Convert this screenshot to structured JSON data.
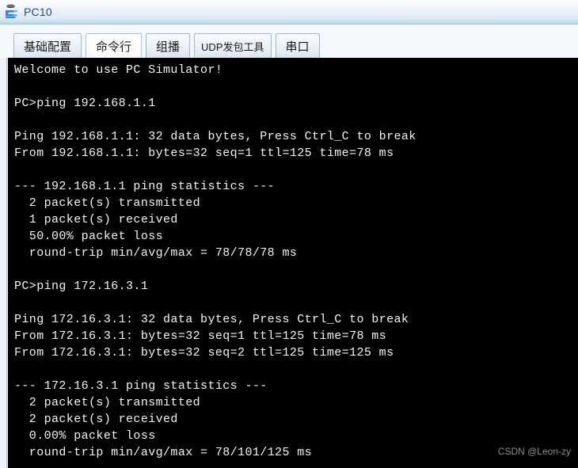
{
  "window": {
    "title": "PC10",
    "icon": "pc-device-icon"
  },
  "tabs": [
    {
      "label": "基础配置",
      "active": false,
      "small": false
    },
    {
      "label": "命令行",
      "active": true,
      "small": false
    },
    {
      "label": "组播",
      "active": false,
      "small": false
    },
    {
      "label": "UDP发包工具",
      "active": false,
      "small": true
    },
    {
      "label": "串口",
      "active": false,
      "small": false
    }
  ],
  "terminal": {
    "background": "#000000",
    "foreground": "#f4f4f4",
    "lines": [
      "Welcome to use PC Simulator!",
      "",
      "PC>ping 192.168.1.1",
      "",
      "Ping 192.168.1.1: 32 data bytes, Press Ctrl_C to break",
      "From 192.168.1.1: bytes=32 seq=1 ttl=125 time=78 ms",
      "",
      "--- 192.168.1.1 ping statistics ---",
      "  2 packet(s) transmitted",
      "  1 packet(s) received",
      "  50.00% packet loss",
      "  round-trip min/avg/max = 78/78/78 ms",
      "",
      "PC>ping 172.16.3.1",
      "",
      "Ping 172.16.3.1: 32 data bytes, Press Ctrl_C to break",
      "From 172.16.3.1: bytes=32 seq=1 ttl=125 time=78 ms",
      "From 172.16.3.1: bytes=32 seq=2 ttl=125 time=125 ms",
      "",
      "--- 172.16.3.1 ping statistics ---",
      "  2 packet(s) transmitted",
      "  2 packet(s) received",
      "  0.00% packet loss",
      "  round-trip min/avg/max = 78/101/125 ms"
    ]
  },
  "watermark": {
    "text": "CSDN @Leon-zy"
  }
}
